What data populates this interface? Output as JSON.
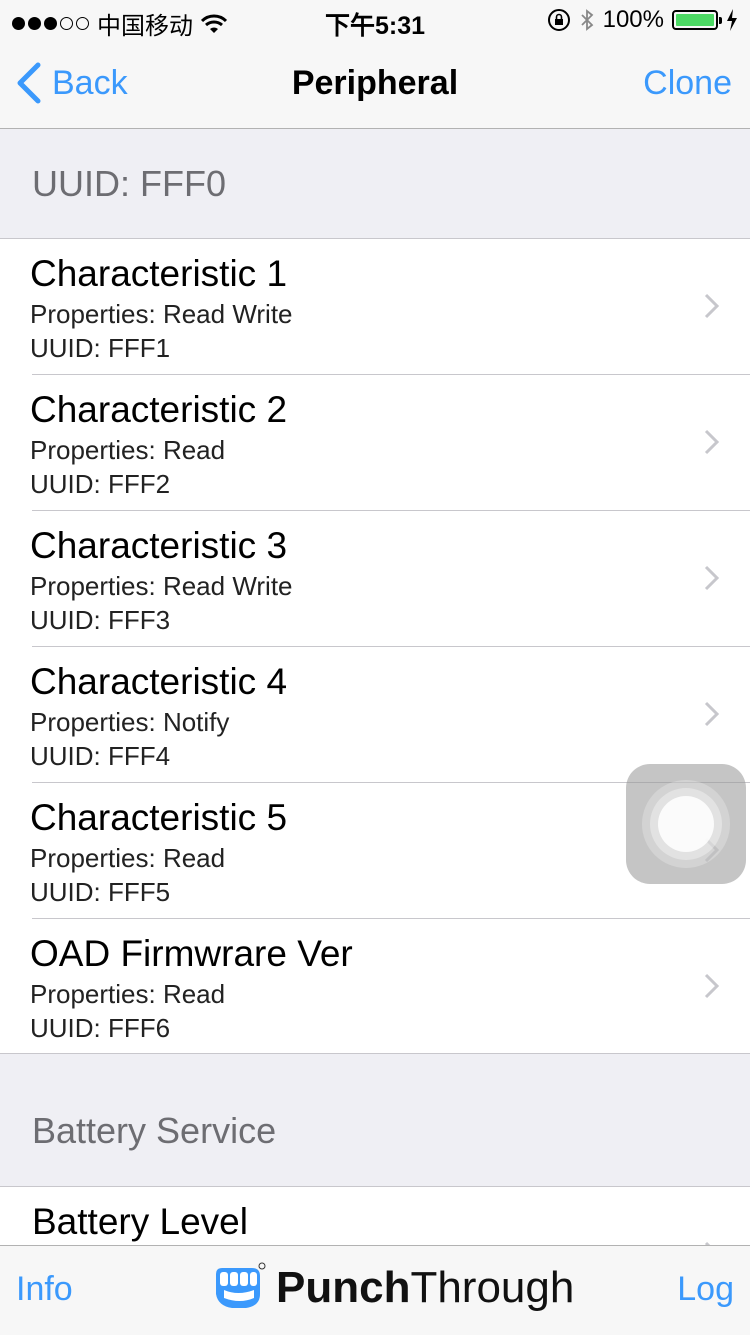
{
  "status_bar": {
    "carrier": "中国移动",
    "time": "下午5:31",
    "battery": "100%"
  },
  "nav": {
    "back_label": "Back",
    "title": "Peripheral",
    "clone_label": "Clone"
  },
  "sections": [
    {
      "header": "UUID: FFF0",
      "rows": [
        {
          "title": "Characteristic 1",
          "properties": "Properties: Read Write",
          "uuid": "UUID: FFF1"
        },
        {
          "title": "Characteristic 2",
          "properties": "Properties: Read",
          "uuid": "UUID: FFF2"
        },
        {
          "title": "Characteristic 3",
          "properties": "Properties: Read Write",
          "uuid": "UUID: FFF3"
        },
        {
          "title": "Characteristic 4",
          "properties": "Properties: Notify",
          "uuid": "UUID: FFF4"
        },
        {
          "title": "Characteristic 5",
          "properties": "Properties: Read",
          "uuid": "UUID: FFF5"
        },
        {
          "title": "OAD Firmwrare Ver",
          "properties": "Properties: Read",
          "uuid": "UUID: FFF6"
        }
      ]
    },
    {
      "header": "Battery Service",
      "rows": [
        {
          "title": "Battery Level"
        }
      ]
    }
  ],
  "toolbar": {
    "info_label": "Info",
    "brand_bold": "Punch",
    "brand_light": "Through",
    "log_label": "Log"
  },
  "colors": {
    "accent": "#3b99fc",
    "battery_fill": "#4cd964"
  }
}
